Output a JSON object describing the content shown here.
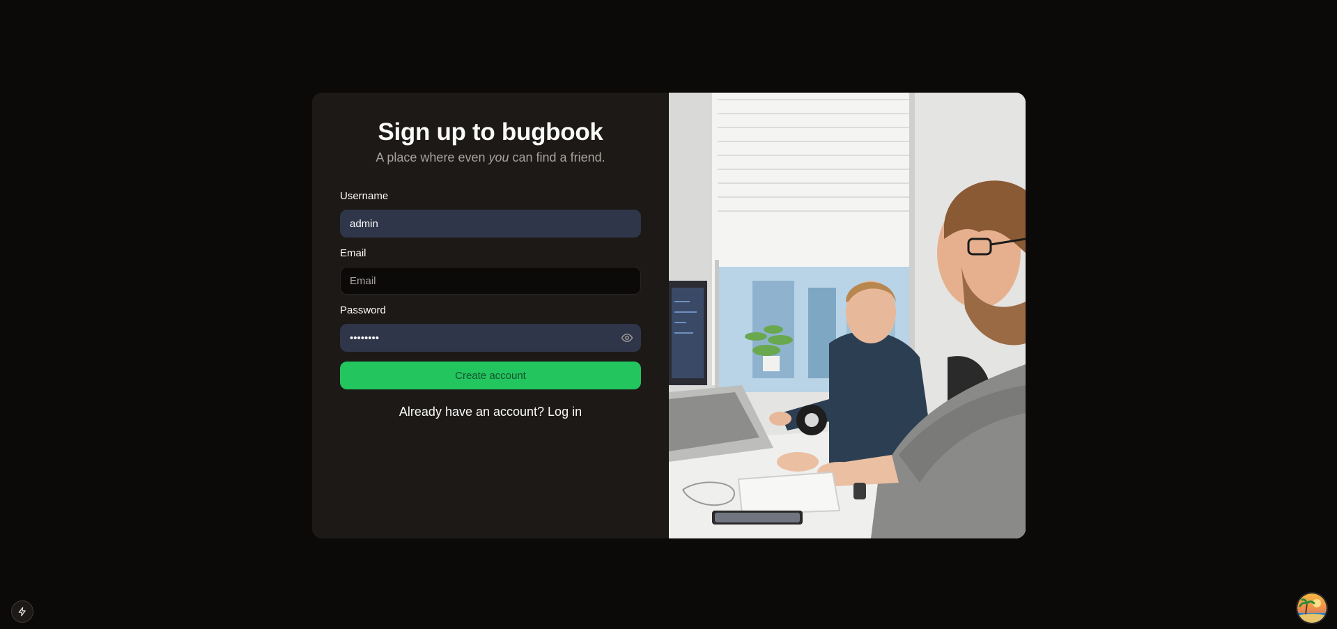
{
  "signup": {
    "title": "Sign up to bugbook",
    "subtitle_before": "A place where even ",
    "subtitle_emph": "you",
    "subtitle_after": " can find a friend.",
    "username_label": "Username",
    "username_value": "admin",
    "email_label": "Email",
    "email_placeholder": "Email",
    "password_label": "Password",
    "password_value": "••••••••",
    "submit_label": "Create account",
    "login_link": "Already have an account? Log in"
  },
  "colors": {
    "page_bg": "#0c0a09",
    "card_bg": "#1c1917",
    "accent": "#22c55e",
    "filled_input": "#30364a"
  },
  "icons": {
    "password_toggle": "eye-icon",
    "corner_badge": "lightning-icon",
    "avatar": "beach-avatar"
  }
}
